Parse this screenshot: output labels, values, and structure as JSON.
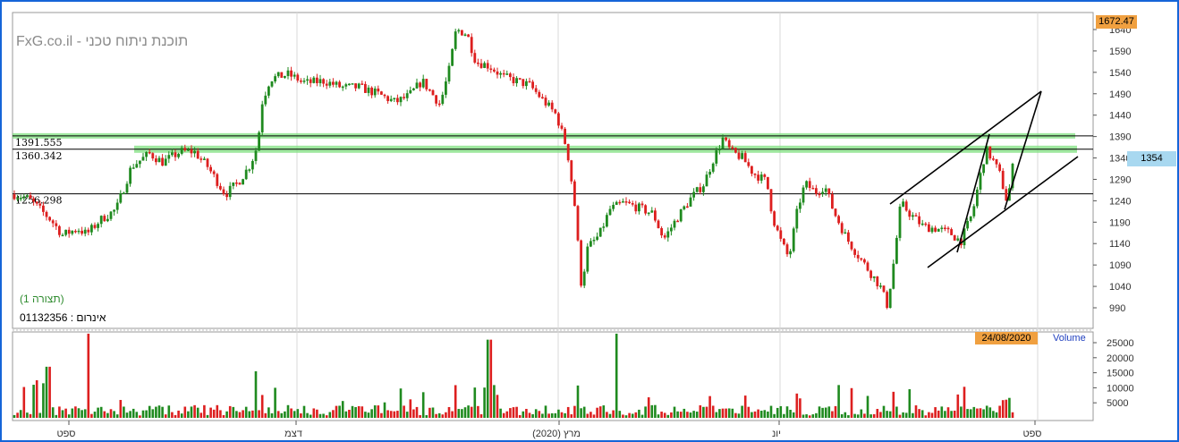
{
  "header": {
    "watermark": "FxG.co.il - תוכנת ניתוח טכני",
    "view_label": "(תצורה 1)",
    "identifier": "אינרום : 01132356"
  },
  "badges": {
    "max_value": "1672.47",
    "last_price": "1354",
    "date": "24/08/2020",
    "volume_label": "Volume"
  },
  "colors": {
    "up": "#1f8a1f",
    "down": "#dd1f1f",
    "frame": "#1565d8",
    "support_band": "#7fe07f",
    "grid": "#d9d9d9"
  },
  "chart_data": [
    {
      "type": "candlestick",
      "yaxis_ticks": [
        990,
        1040,
        1090,
        1140,
        1190,
        1240,
        1290,
        1340,
        1390,
        1440,
        1490,
        1540,
        1590,
        1640
      ],
      "ylim": [
        965,
        1660
      ],
      "xaxis_ticks": [
        "ספט",
        "דצמ",
        "מרץ (2020)",
        "יונ",
        "ספט"
      ],
      "horizontal_levels": [
        {
          "label": "1391.555",
          "value": 1391.555
        },
        {
          "label": "1360.342",
          "value": 1360.342
        },
        {
          "label": "1256.298",
          "value": 1256.298
        }
      ],
      "last_price": 1354,
      "max_value": 1672.47,
      "trend_channel": "upward parallel channel, Jul–Aug 2020",
      "grid": true
    },
    {
      "type": "bar",
      "name": "Volume",
      "yaxis_ticks": [
        5000,
        10000,
        15000,
        20000,
        25000
      ],
      "ylim": [
        0,
        28000
      ],
      "grid": true
    }
  ]
}
